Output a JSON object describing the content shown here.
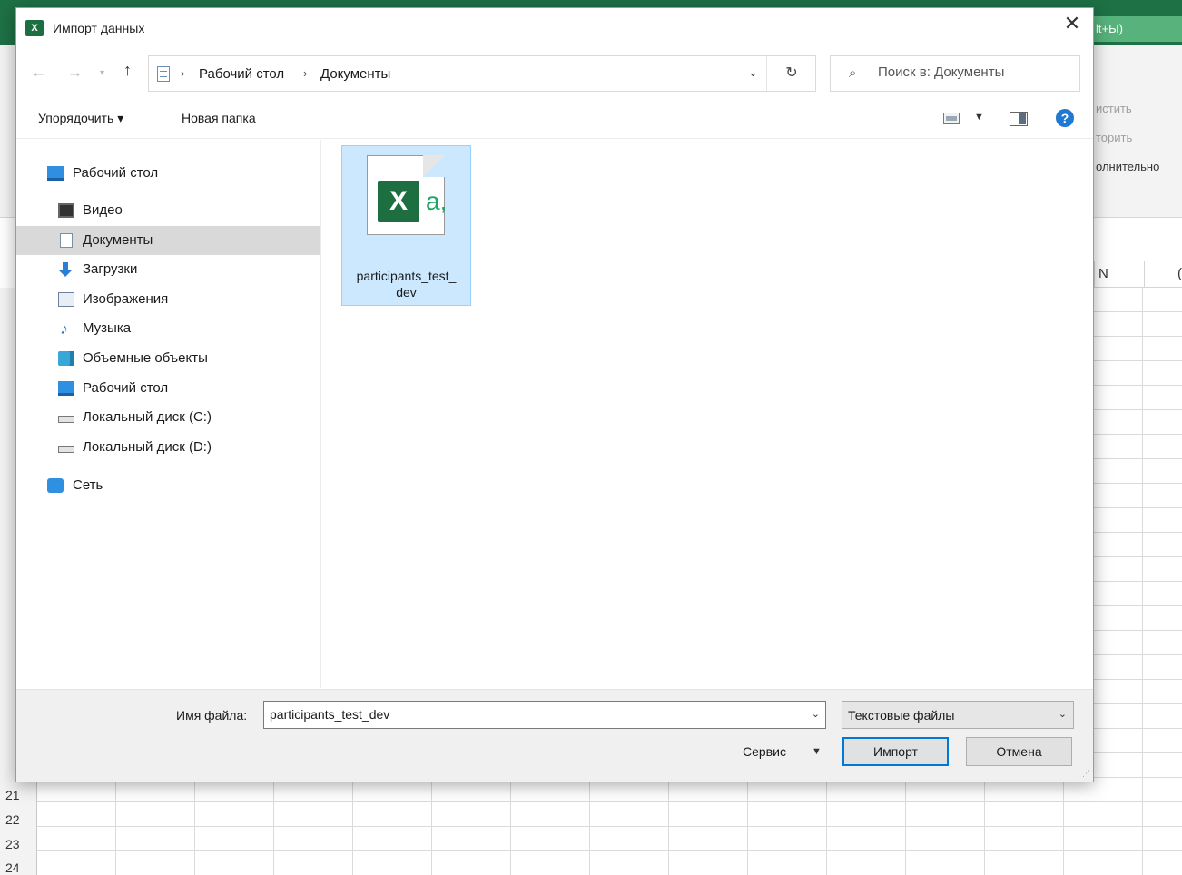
{
  "background": {
    "ribbon_tail": "lt+Ы)",
    "ribbon_items": [
      "истить",
      "торить",
      "олнительно"
    ],
    "col_heads": [
      "N",
      "("
    ],
    "row_numbers": [
      "21",
      "22",
      "23",
      "24"
    ]
  },
  "dialog": {
    "title": "Импорт данных",
    "app_badge": "X"
  },
  "navbar": {
    "path": [
      "Рабочий стол",
      "Документы"
    ],
    "search_placeholder": "Поиск в: Документы"
  },
  "toolbar": {
    "organize": "Упорядочить ▾",
    "new_folder": "Новая папка"
  },
  "sidebar": {
    "items": [
      {
        "label": "Рабочий стол",
        "icon": "desktop-icon"
      },
      {
        "label": "Видео",
        "icon": "video-icon"
      },
      {
        "label": "Документы",
        "icon": "documents-icon",
        "selected": true
      },
      {
        "label": "Загрузки",
        "icon": "downloads-icon"
      },
      {
        "label": "Изображения",
        "icon": "images-icon"
      },
      {
        "label": "Музыка",
        "icon": "music-icon"
      },
      {
        "label": "Объемные объекты",
        "icon": "3d-objects-icon"
      },
      {
        "label": "Рабочий стол",
        "icon": "desktop-icon"
      },
      {
        "label": "Локальный диск (C:)",
        "icon": "drive-c-icon"
      },
      {
        "label": "Локальный диск (D:)",
        "icon": "drive-d-icon"
      },
      {
        "label": "Сеть",
        "icon": "network-icon"
      }
    ]
  },
  "files": [
    {
      "name": "participants_test_dev",
      "name_display": "participants_test_\ndev",
      "icon": "excel-csv-icon",
      "icon_letters": "X",
      "icon_suffix": "a,"
    }
  ],
  "bottom": {
    "filename_label": "Имя файла:",
    "filename_value": "participants_test_dev",
    "filetype": "Текстовые файлы",
    "service": "Сервис",
    "import_button": "Импорт",
    "cancel_button": "Отмена"
  },
  "colors": {
    "excel_green": "#1d6f42",
    "selection_blue": "#cce8ff",
    "accent_blue": "#0078d7"
  }
}
